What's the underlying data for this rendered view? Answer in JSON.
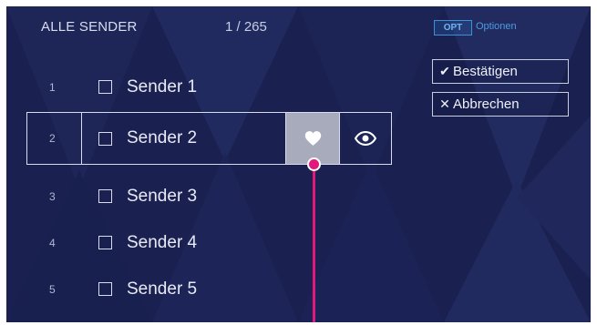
{
  "header": {
    "title": "ALLE SENDER",
    "count": "1 / 265"
  },
  "options": {
    "badge": "OPT",
    "label": "Optionen"
  },
  "actions": {
    "confirm_label": "Bestätigen",
    "cancel_label": "Abbrechen"
  },
  "channels": [
    {
      "number": "1",
      "name": "Sender 1",
      "checked": false,
      "selected": false
    },
    {
      "number": "2",
      "name": "Sender 2",
      "checked": false,
      "selected": true
    },
    {
      "number": "3",
      "name": "Sender 3",
      "checked": false,
      "selected": false
    },
    {
      "number": "4",
      "name": "Sender 4",
      "checked": false,
      "selected": false
    },
    {
      "number": "5",
      "name": "Sender 5",
      "checked": false,
      "selected": false
    }
  ],
  "icons": {
    "favorite": "heart-icon",
    "view": "eye-icon",
    "confirm": "check-icon",
    "cancel": "x-icon"
  },
  "colors": {
    "background": "#1a2150",
    "accent_blue": "#4f9be0",
    "pointer": "#e2187a",
    "favorite_button": "#a8abbc"
  }
}
